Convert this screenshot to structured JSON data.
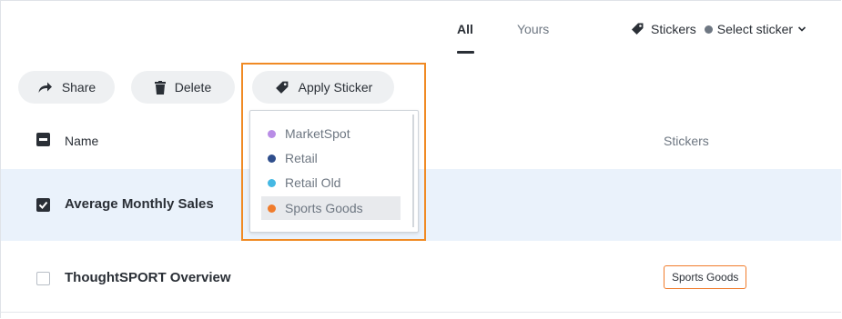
{
  "tabs": [
    {
      "label": "All",
      "active": true
    },
    {
      "label": "Yours",
      "active": false
    }
  ],
  "filter": {
    "stickers_label": "Stickers",
    "select_label": "Select sticker"
  },
  "toolbar": {
    "share_label": "Share",
    "delete_label": "Delete",
    "apply_sticker_label": "Apply Sticker"
  },
  "table": {
    "columns": [
      "Name",
      "Stickers"
    ],
    "rows": [
      {
        "name": "Average Monthly Sales",
        "checked": true,
        "sticker": ""
      },
      {
        "name": "ThoughtSPORT Overview",
        "checked": false,
        "sticker": "Sports Goods"
      }
    ]
  },
  "sticker_menu": {
    "items": [
      {
        "label": "MarketSpot",
        "color": "#b98de6"
      },
      {
        "label": "Retail",
        "color": "#2f4e8c"
      },
      {
        "label": "Retail Old",
        "color": "#45b8e3"
      },
      {
        "label": "Sports Goods",
        "color": "#f07c2c",
        "hovered": true
      }
    ]
  },
  "colors": {
    "accent_highlight": "#f08a24",
    "selected_row": "#eaf2fb",
    "text": "#2a2f36",
    "muted": "#6e7782"
  }
}
